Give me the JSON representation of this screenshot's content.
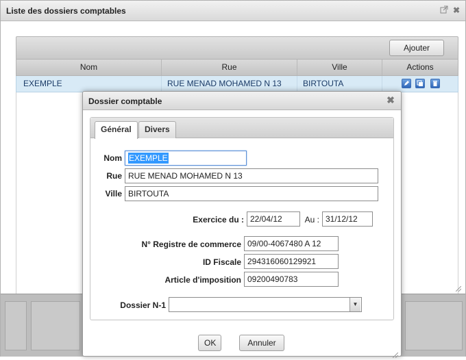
{
  "window": {
    "title": "Liste des dossiers comptables",
    "popout_icon": "popout-icon",
    "close_icon": "close-icon"
  },
  "toolbar": {
    "add_button": "Ajouter (F2)"
  },
  "table": {
    "columns": [
      "Nom",
      "Rue",
      "Ville",
      "Actions"
    ],
    "rows": [
      {
        "nom": "EXEMPLE",
        "rue": "RUE MENAD MOHAMED N 13",
        "ville": "BIRTOUTA",
        "actions": [
          "edit-icon",
          "copy-icon",
          "delete-icon"
        ]
      }
    ]
  },
  "dialog": {
    "title": "Dossier comptable",
    "tabs": [
      {
        "label": "Général",
        "active": true
      },
      {
        "label": "Divers",
        "active": false
      }
    ],
    "fields": {
      "nom_label": "Nom",
      "nom_value": "EXEMPLE",
      "rue_label": "Rue",
      "rue_value": "RUE MENAD MOHAMED N 13",
      "ville_label": "Ville",
      "ville_value": "BIRTOUTA",
      "exercice_label": "Exercice du :",
      "exercice_from": "22/04/12",
      "au_label": "Au :",
      "exercice_to": "31/12/12",
      "registre_label": "N° Registre de commerce",
      "registre_value": "09/00-4067480 A 12",
      "fiscal_label": "ID Fiscale",
      "fiscal_value": "294316060129921",
      "article_label": "Article d'imposition",
      "article_value": "09200490783",
      "dossier_n1_label": "Dossier N-1",
      "dossier_n1_value": ""
    },
    "ok_button": "OK",
    "cancel_button": "Annuler"
  },
  "colors": {
    "selected_row": "#d8eaf6",
    "selection_highlight": "#3399ff",
    "action_icon": "#2f67b8"
  }
}
